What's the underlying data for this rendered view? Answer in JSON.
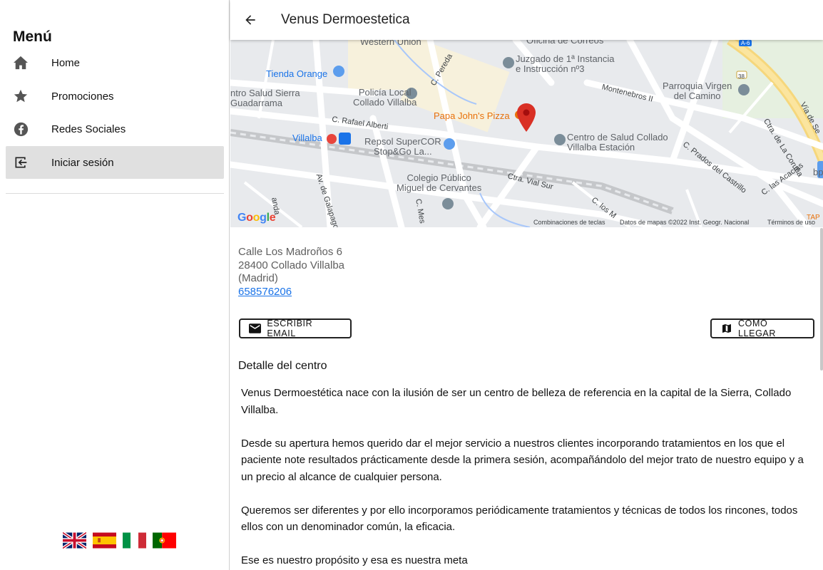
{
  "sidebar": {
    "title": "Menú",
    "items": [
      {
        "label": "Home",
        "icon": "home-icon"
      },
      {
        "label": "Promociones",
        "icon": "star-icon"
      },
      {
        "label": "Redes Sociales",
        "icon": "facebook-icon"
      },
      {
        "label": "Iniciar sesión",
        "icon": "login-icon",
        "active": true
      }
    ],
    "languages": [
      "uk-flag",
      "spain-flag",
      "italy-flag",
      "portugal-flag"
    ]
  },
  "header": {
    "title": "Venus Dermoestetica",
    "back_icon": "arrow-back-icon"
  },
  "map": {
    "labels": {
      "western_union": "Western Union",
      "oficina_correos": "Oficina de Correos",
      "juzgado": "Juzgado de 1ª Instancia\ne Instrucción nº3",
      "tienda_orange": "Tienda Orange",
      "salud_sierra": "ntro Salud Sierra\nGuadarrama",
      "policia": "Policía Local\nCollado Villalba",
      "c_pereda": "C. Pereda",
      "montenebros": "Montenebros II",
      "parroquia": "Parroquia Virgen\ndel Camino",
      "ctra_coruna": "Ctra. de La Coruña",
      "via_servicio": "Vía de Se",
      "c_rafael": "C. Rafael Alberti",
      "papa_johns": "Papa John's Pizza",
      "villalba": "Villalba",
      "repsol": "Repsol SuperCOR\nStop&Go La...",
      "centro_salud": "Centro de Salud Collado\nVillalba Estación",
      "c_prados": "C. Prados del Castrillo",
      "c_acacias": "C. las Acacias",
      "bp": "bp",
      "colegio": "Colegio Público\nMiguel de Cervantes",
      "ctra_vial": "Ctra. Vial Sur",
      "av_galapagar": "Av. de Galapago",
      "c_mesa": "C. Mes",
      "c_los": "C. los M",
      "c_anda": "anda",
      "a6": "A-6",
      "road38": "38",
      "tap": "TAP"
    },
    "google": "Google",
    "footer_shortcuts": "Combinaciones de teclas",
    "footer_data": "Datos de mapas ©2022 Inst. Geogr. Nacional",
    "footer_terms": "Términos de uso"
  },
  "address": {
    "line1": "Calle Los Madroños 6",
    "line2": "28400 Collado Villalba",
    "line3": "(Madrid)",
    "phone": "658576206"
  },
  "actions": {
    "email_label": "ESCRIBIR EMAIL",
    "directions_label": "COMO LLEGAR"
  },
  "detail": {
    "title": "Detalle del centro",
    "paragraphs": [
      "Venus Dermoestética nace con la ilusión de ser un centro de belleza de referencia en la capital de la Sierra, Collado Villalba.",
      "Desde su apertura hemos querido dar el mejor servicio a nuestros clientes incorporando tratamientos en los que el paciente note resultados prácticamente desde la primera sesión, acompañándolo del mejor trato de nuestro equipo y a un precio al alcance de cualquier persona.",
      "Queremos ser diferentes y por ello incorporamos periódicamente tratamientos y técnicas de todos los rincones, todos ellos con un denominador común, la eficacia.",
      "Ese es nuestro propósito y esa es nuestra meta"
    ]
  },
  "colors": {
    "link": "#1a73e8",
    "active_bg": "#e0e0e0",
    "map_bg": "#e8eaed",
    "marker": "#d93025"
  }
}
